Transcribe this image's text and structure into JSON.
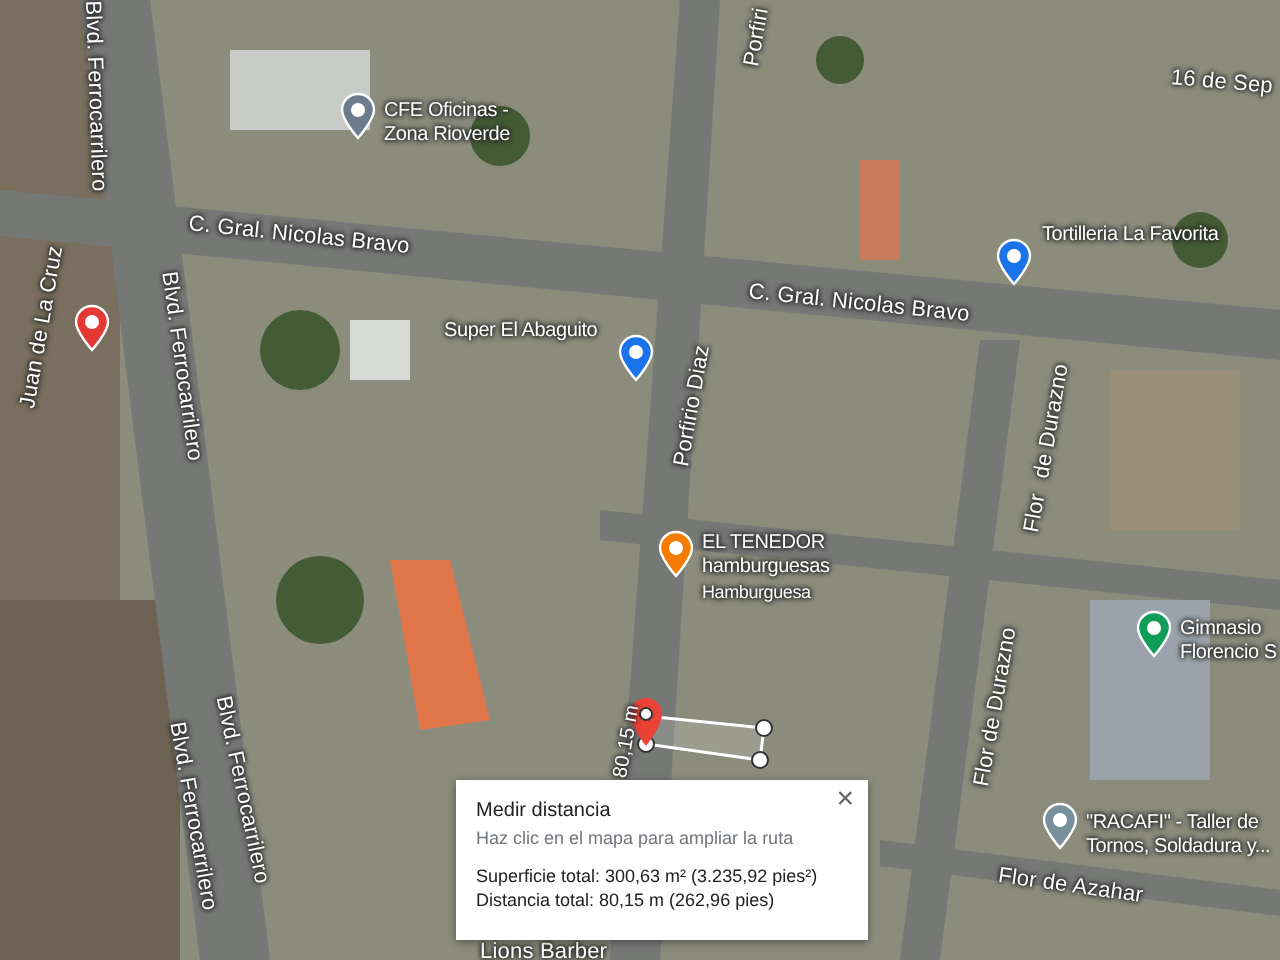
{
  "map_labels": [
    {
      "kind": "street",
      "text": "Blvd. Ferrocarrilero"
    },
    {
      "kind": "street",
      "text": "C. Gral. Nicolas Bravo"
    },
    {
      "kind": "street",
      "text": "Juan de La Cruz"
    },
    {
      "kind": "street",
      "text": "Blvd. Ferrocarrilero"
    },
    {
      "kind": "street",
      "text": "Porfiri"
    },
    {
      "kind": "street",
      "text": "C. Gral. Nicolas Bravo"
    },
    {
      "kind": "street",
      "text": "16 de Sep"
    },
    {
      "kind": "street",
      "text": "Porfirio Diaz"
    },
    {
      "kind": "street",
      "text": "de Durazno"
    },
    {
      "kind": "street",
      "text": "Blvd. Ferrocarrilero"
    },
    {
      "kind": "street",
      "text": "Blvd. Ferrocarrilero"
    },
    {
      "kind": "street",
      "text": "Flor"
    },
    {
      "kind": "street",
      "text": "Flor de Durazno"
    },
    {
      "kind": "street",
      "text": "Flor de Azahar"
    },
    {
      "kind": "distance",
      "text": "80,15 m"
    },
    {
      "kind": "street",
      "text": "Lions Barber"
    }
  ],
  "places": [
    {
      "lines": [
        "CFE Oficinas -",
        "Zona Rioverde"
      ],
      "color": "#6b7c8e"
    },
    {
      "lines": [
        "Super El Abaguito"
      ],
      "color": "#1a73e8"
    },
    {
      "lines": [
        "Tortilleria La Favorita"
      ],
      "color": "#1a73e8"
    },
    {
      "color": "#e53935"
    },
    {
      "lines": [
        "EL TENEDOR",
        "hamburguesas",
        "Hamburguesa"
      ],
      "color": "#f57c00"
    },
    {
      "lines": [
        "Gimnasio",
        "Florencio S"
      ],
      "color": "#0f9d58"
    },
    {
      "lines": [
        "\"RACAFI\" - Taller de",
        "Tornos, Soldadura y..."
      ],
      "color": "#78909c"
    }
  ],
  "measure_popup": {
    "title": "Medir distancia",
    "hint": "Haz clic en el mapa para ampliar la ruta",
    "lines": [
      "Superficie total: 300,63 m² (3.235,92 pies²)",
      "Distancia total: 80,15 m (262,96 pies)"
    ],
    "close": "×"
  }
}
